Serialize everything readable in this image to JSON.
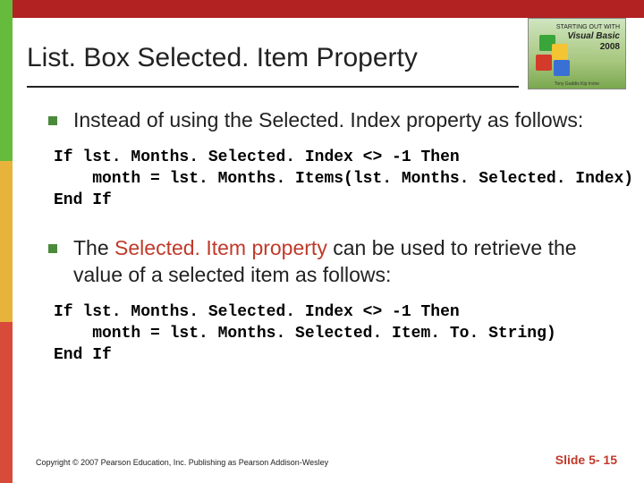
{
  "title": "List. Box Selected. Item Property",
  "logo": {
    "line1": "STARTING OUT WITH",
    "vb": "Visual Basic",
    "year": "2008",
    "sub": "Tony Gaddis   Kip Irvine"
  },
  "bullets": [
    {
      "text_before": "Instead of using the Selected. Index property as follows:",
      "highlight": ""
    },
    {
      "text_before": "The ",
      "highlight": "Selected. Item property",
      "text_after": " can be used to retrieve the value of a selected item as follows:"
    }
  ],
  "code": [
    "If lst. Months. Selected. Index <> -1 Then\n    month = lst. Months. Items(lst. Months. Selected. Index)\nEnd If",
    "If lst. Months. Selected. Index <> -1 Then\n    month = lst. Months. Selected. Item. To. String)\nEnd If"
  ],
  "footer": {
    "copyright": "Copyright © 2007 Pearson Education, Inc. Publishing as Pearson Addison-Wesley",
    "slide": "Slide 5- 15"
  }
}
